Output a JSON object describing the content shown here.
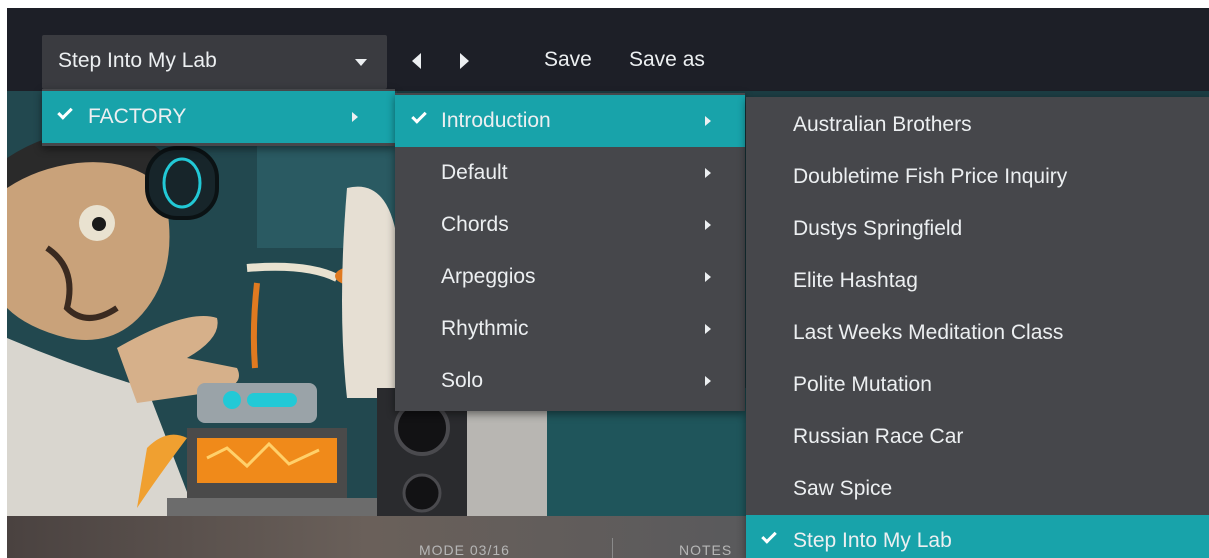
{
  "toolbar": {
    "preset_name": "Step Into My Lab",
    "save_label": "Save",
    "save_as_label": "Save as"
  },
  "menu_bank": {
    "items": [
      {
        "label": "FACTORY",
        "checked": true,
        "submenu": true
      }
    ]
  },
  "menu_category": {
    "items": [
      {
        "label": "Introduction",
        "checked": true,
        "submenu": true
      },
      {
        "label": "Default",
        "checked": false,
        "submenu": true
      },
      {
        "label": "Chords",
        "checked": false,
        "submenu": true
      },
      {
        "label": "Arpeggios",
        "checked": false,
        "submenu": true
      },
      {
        "label": "Rhythmic",
        "checked": false,
        "submenu": true
      },
      {
        "label": "Solo",
        "checked": false,
        "submenu": true
      }
    ]
  },
  "menu_presets": {
    "items": [
      {
        "label": "Australian Brothers",
        "checked": false
      },
      {
        "label": "Doubletime Fish Price Inquiry",
        "checked": false
      },
      {
        "label": "Dustys Springfield",
        "checked": false
      },
      {
        "label": "Elite Hashtag",
        "checked": false
      },
      {
        "label": "Last Weeks Meditation Class",
        "checked": false
      },
      {
        "label": "Polite Mutation",
        "checked": false
      },
      {
        "label": "Russian Race Car",
        "checked": false
      },
      {
        "label": "Saw Spice",
        "checked": false
      },
      {
        "label": "Step Into My Lab",
        "checked": true
      }
    ]
  },
  "bottom_bar": {
    "mode_text": "MODE 03/16",
    "notes_text": "NOTES"
  },
  "colors": {
    "toolbar_bg": "#1d1f27",
    "menu_bg": "#46474b",
    "highlight": "#18a3aa",
    "text": "#eceff1"
  }
}
